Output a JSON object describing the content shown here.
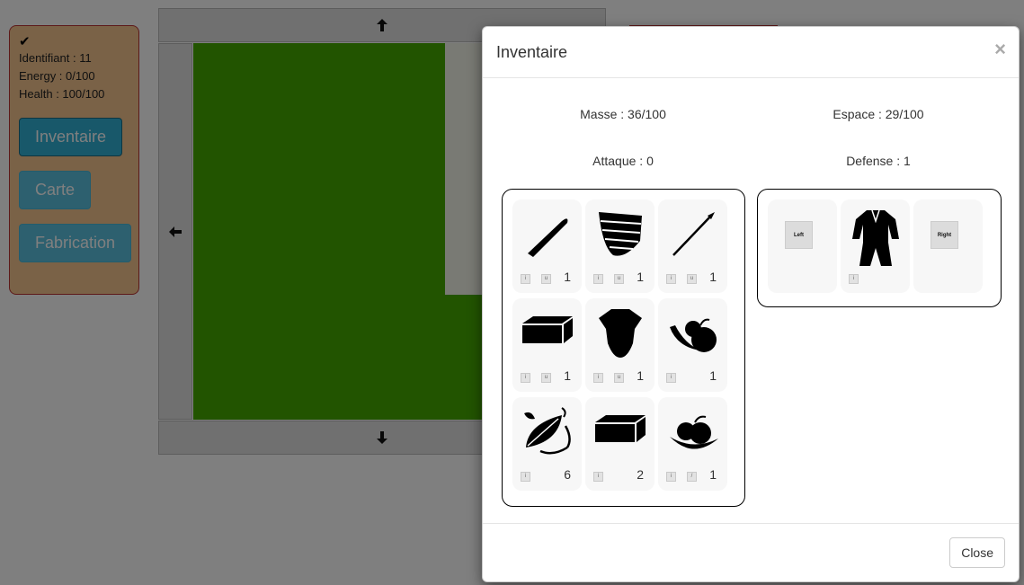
{
  "status": {
    "id_line": "Identifiant : 11",
    "energy_line": "Energy : 0/100",
    "health_line": "Health : 100/100"
  },
  "nav": {
    "inventaire": "Inventaire",
    "carte": "Carte",
    "fabrication": "Fabrication"
  },
  "modal": {
    "title": "Inventaire",
    "close_x": "×",
    "masse": "Masse : 36/100",
    "espace": "Espace : 29/100",
    "attaque": "Attaque : 0",
    "defense": "Defense : 1",
    "close_button": "Close"
  },
  "inventory": [
    {
      "icon": "club-icon",
      "qty": "1"
    },
    {
      "icon": "chest-armor-icon",
      "qty": "1"
    },
    {
      "icon": "spear-icon",
      "qty": "1"
    },
    {
      "icon": "block-icon",
      "qty": "1"
    },
    {
      "icon": "torso-armor-icon",
      "qty": "1"
    },
    {
      "icon": "fruits-icon",
      "qty": "1"
    },
    {
      "icon": "leaves-icon",
      "qty": "6"
    },
    {
      "icon": "block-icon",
      "qty": "2"
    },
    {
      "icon": "fruit-bowl-icon",
      "qty": "1"
    }
  ],
  "equipment": {
    "left_label": "Left",
    "right_label": "Right",
    "body_icon": "outfit-icon"
  }
}
